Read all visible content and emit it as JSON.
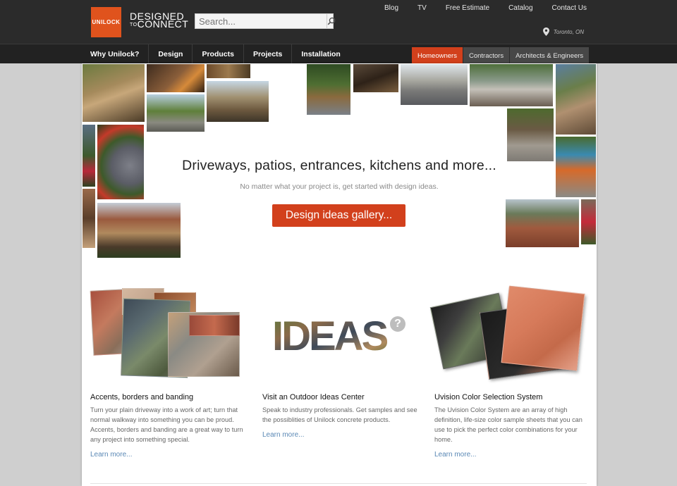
{
  "brand": {
    "logo_text": "UNILOCK",
    "tagline_line1": "DESIGNED",
    "tagline_to": "TO",
    "tagline_line2": "CONNECT"
  },
  "search": {
    "placeholder": "Search..."
  },
  "top_links": [
    "Blog",
    "TV",
    "Free Estimate",
    "Catalog",
    "Contact Us"
  ],
  "location": "Toronto, ON",
  "main_nav": [
    "Why Unilock?",
    "Design",
    "Products",
    "Projects",
    "Installation"
  ],
  "audience_tabs": [
    {
      "label": "Homeowners",
      "active": true
    },
    {
      "label": "Contractors",
      "active": false
    },
    {
      "label": "Architects & Engineers",
      "active": false
    }
  ],
  "hero": {
    "title": "Driveways, patios, entrances, kitchens and more...",
    "subtitle": "No matter what your project is, get started with design ideas.",
    "button": "Design ideas gallery..."
  },
  "features": [
    {
      "title": "Accents, borders and banding",
      "description": "Turn your plain driveway into a work of art; turn that normal walkway into something you can be proud. Accents, borders and banding are a great way to turn any project into something special.",
      "link": "Learn more..."
    },
    {
      "title": "Visit an Outdoor Ideas Center",
      "description": "Speak to industry professionals. Get samples and see the possiblities of Unilock concrete products.",
      "link": "Learn more...",
      "image_text": "IDEAS",
      "badge": "?"
    },
    {
      "title": "Uvision Color Selection System",
      "description": "The Uvision Color System are an array of high definition, life-size color sample sheets that you can use to pick the perfect color combinations for your home.",
      "link": "Learn more..."
    }
  ],
  "colors": {
    "accent": "#d2401c",
    "logo_orange": "#e0531d",
    "topbar": "#2b2b2b",
    "link_blue": "#5a88b5"
  },
  "icons": {
    "search": "search-icon",
    "location": "location-pin-icon",
    "help": "question-badge-icon"
  }
}
